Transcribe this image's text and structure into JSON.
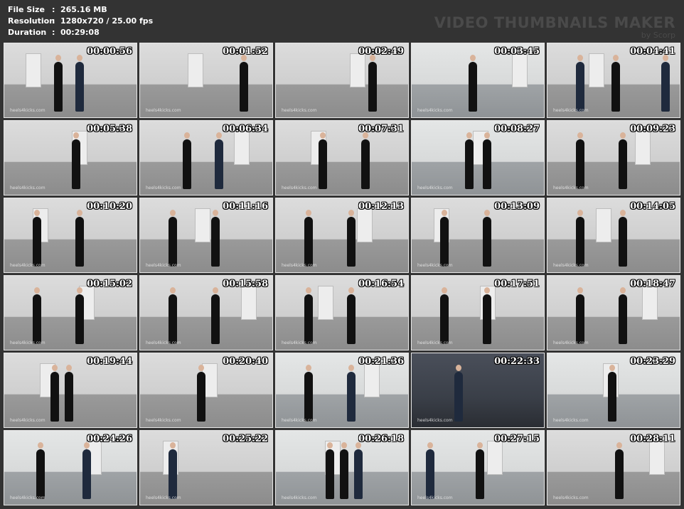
{
  "info": {
    "file_size_label": "File Size",
    "file_size_value": "265.16 MB",
    "resolution_label": "Resolution",
    "resolution_value": "1280x720 / 25.00 fps",
    "duration_label": "Duration",
    "duration_value": "00:29:08"
  },
  "brand": {
    "title": "VIDEO THUMBNAILS MAKER",
    "sub": "by Scorp"
  },
  "watermark": "heels4kicks.com",
  "thumbnails": [
    {
      "time": "00:00:56",
      "tone": "light"
    },
    {
      "time": "00:01:52",
      "tone": "light"
    },
    {
      "time": "00:02:49",
      "tone": "light"
    },
    {
      "time": "00:03:45",
      "tone": "mid"
    },
    {
      "time": "00:04:41",
      "tone": "light"
    },
    {
      "time": "00:05:38",
      "tone": "light"
    },
    {
      "time": "00:06:34",
      "tone": "light"
    },
    {
      "time": "00:07:31",
      "tone": "light"
    },
    {
      "time": "00:08:27",
      "tone": "mid"
    },
    {
      "time": "00:09:23",
      "tone": "light"
    },
    {
      "time": "00:10:20",
      "tone": "light"
    },
    {
      "time": "00:11:16",
      "tone": "light"
    },
    {
      "time": "00:12:13",
      "tone": "light"
    },
    {
      "time": "00:13:09",
      "tone": "light"
    },
    {
      "time": "00:14:05",
      "tone": "light"
    },
    {
      "time": "00:15:02",
      "tone": "light"
    },
    {
      "time": "00:15:58",
      "tone": "light"
    },
    {
      "time": "00:16:54",
      "tone": "light"
    },
    {
      "time": "00:17:51",
      "tone": "light"
    },
    {
      "time": "00:18:47",
      "tone": "light"
    },
    {
      "time": "00:19:44",
      "tone": "light"
    },
    {
      "time": "00:20:40",
      "tone": "light"
    },
    {
      "time": "00:21:36",
      "tone": "mid"
    },
    {
      "time": "00:22:33",
      "tone": "dark"
    },
    {
      "time": "00:23:29",
      "tone": "mid"
    },
    {
      "time": "00:24:26",
      "tone": "mid"
    },
    {
      "time": "00:25:22",
      "tone": "light"
    },
    {
      "time": "00:26:18",
      "tone": "mid"
    },
    {
      "time": "00:27:15",
      "tone": "mid"
    },
    {
      "time": "00:28:11",
      "tone": "light"
    }
  ]
}
